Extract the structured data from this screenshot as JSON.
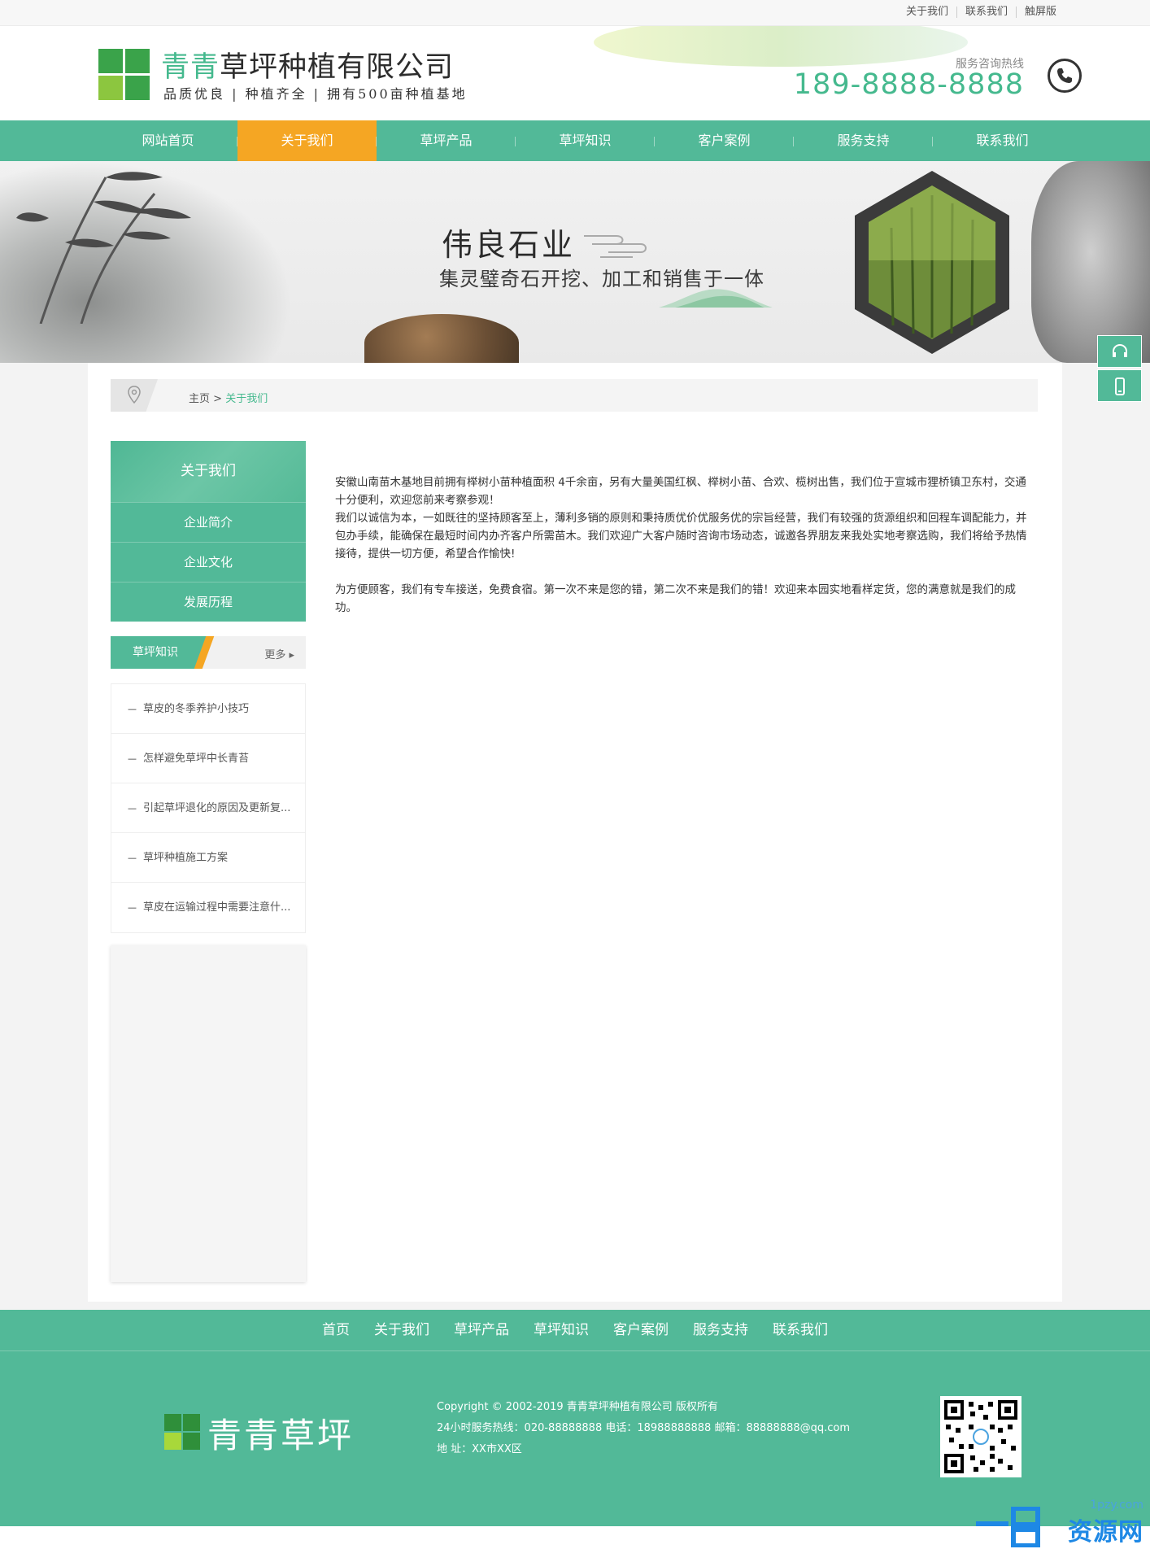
{
  "topbar": {
    "links": [
      "关于我们",
      "联系我们",
      "触屏版"
    ]
  },
  "header": {
    "logo_title_green": "青青",
    "logo_title_rest": "草坪种植有限公司",
    "slogan": "品质优良 | 种植齐全 | 拥有500亩种植基地",
    "hotline_label": "服务咨询热线",
    "hotline_number": "189-8888-8888"
  },
  "nav": {
    "items": [
      "网站首页",
      "关于我们",
      "草坪产品",
      "草坪知识",
      "客户案例",
      "服务支持",
      "联系我们"
    ],
    "active_index": 1
  },
  "banner": {
    "title": "伟良石业",
    "subtitle": "集灵璧奇石开挖、加工和销售于一体"
  },
  "breadcrumb": {
    "home": "主页",
    "sep": " > ",
    "current": "关于我们"
  },
  "sidebar": {
    "heading": "关于我们",
    "items": [
      "企业简介",
      "企业文化",
      "发展历程"
    ],
    "knowledge_title": "草坪知识",
    "more_label": "更多",
    "articles": [
      "草皮的冬季养护小技巧",
      "怎样避免草坪中长青苔",
      "引起草坪退化的原因及更新复...",
      "草坪种植施工方案",
      "草皮在运输过程中需要注意什..."
    ]
  },
  "article": {
    "p1": " 安徽山南苗木基地目前拥有榉树小苗种植面积 4千余亩，另有大量美国红枫、榉树小苗、合欢、榄树出售，我们位于宣城市狸桥镇卫东村，交通十分便利，欢迎您前来考察参观！",
    "p2": "我们以诚信为本，一如既往的坚持顾客至上，薄利多销的原则和秉持质优价优服务优的宗旨经营，我们有较强的货源组织和回程车调配能力，并包办手续，能确保在最短时间内办齐客户所需苗木。我们欢迎广大客户随时咨询市场动态，诚邀各界朋友来我处实地考察选购，我们将给予热情接待，提供一切方便，希望合作愉快!",
    "p3": "为方便顾客，我们有专车接送，免费食宿。第一次不来是您的错，第二次不来是我们的错！欢迎来本园实地看样定货，您的满意就是我们的成功。"
  },
  "footer": {
    "nav": [
      "首页",
      "关于我们",
      "草坪产品",
      "草坪知识",
      "客户案例",
      "服务支持",
      "联系我们"
    ],
    "logo_text": "青青草坪",
    "copyright": "Copyright © 2002-2019 青青草坪种植有限公司 版权所有",
    "contact": "24小时服务热线：020-88888888 电话：18988888888 邮箱：88888888@qq.com",
    "address": "地 址：XX市XX区"
  },
  "watermark": {
    "domain": "1pzy.com",
    "brand": "资源网"
  },
  "colors": {
    "green": "#52b998",
    "orange": "#f5a623",
    "dark_green": "#45b98e"
  }
}
